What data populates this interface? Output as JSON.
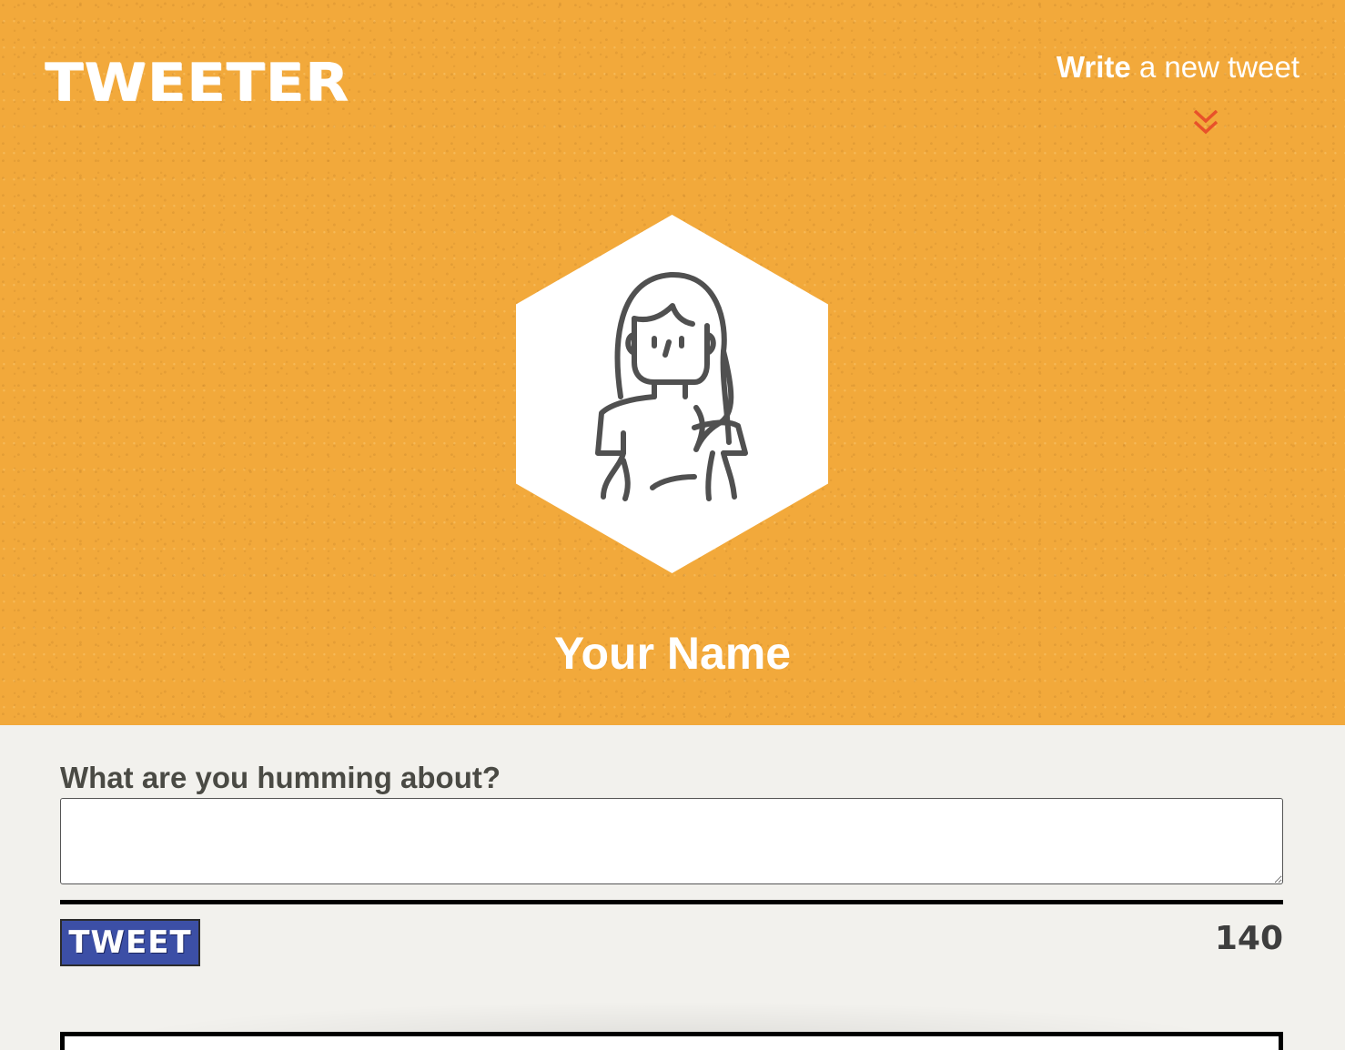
{
  "header": {
    "logo": "TWEETER",
    "compose_toggle": {
      "strong": "Write",
      "rest": " a new tweet",
      "icon": "double-chevron-down-icon"
    }
  },
  "profile": {
    "avatar_icon": "user-avatar-icon",
    "name": "Your Name"
  },
  "composer": {
    "label": "What are you humming about?",
    "textarea_value": "",
    "tweet_button_label": "TWEET",
    "char_counter": "140"
  },
  "colors": {
    "hero_background": "#f2a93b",
    "page_background": "#f2f1ed",
    "accent_chevron": "#e8512a",
    "button_background": "#3c4fa6"
  }
}
